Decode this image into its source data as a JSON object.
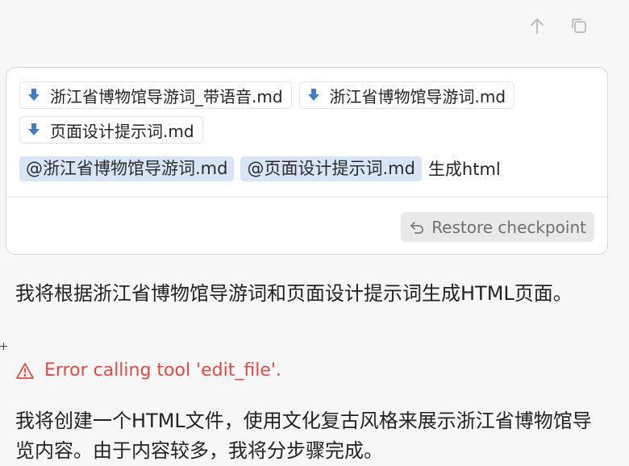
{
  "toolbar": {
    "icons": [
      "arrow-up-icon",
      "copy-icon"
    ]
  },
  "composer": {
    "attachments": [
      {
        "label": "浙江省博物馆导游词_带语音.md",
        "icon": "download-arrow-icon"
      },
      {
        "label": "浙江省博物馆导游词.md",
        "icon": "download-arrow-icon"
      },
      {
        "label": "页面设计提示词.md",
        "icon": "download-arrow-icon"
      }
    ],
    "mentions": [
      "@浙江省博物馆导游词.md",
      "@页面设计提示词.md"
    ],
    "prompt_text": "生成html",
    "restore_label": "Restore checkpoint"
  },
  "messages": {
    "first": "我将根据浙江省博物馆导游词和页面设计提示词生成HTML页面。",
    "error": "Error calling tool 'edit_file'.",
    "second": "我将创建一个HTML文件，使用文化复古风格来展示浙江省博物馆导览内容。由于内容较多，我将分步骤完成。"
  },
  "colors": {
    "mention_bg": "#d7e5f7",
    "error": "#e04a43",
    "file_icon": "#3d7fc1"
  }
}
